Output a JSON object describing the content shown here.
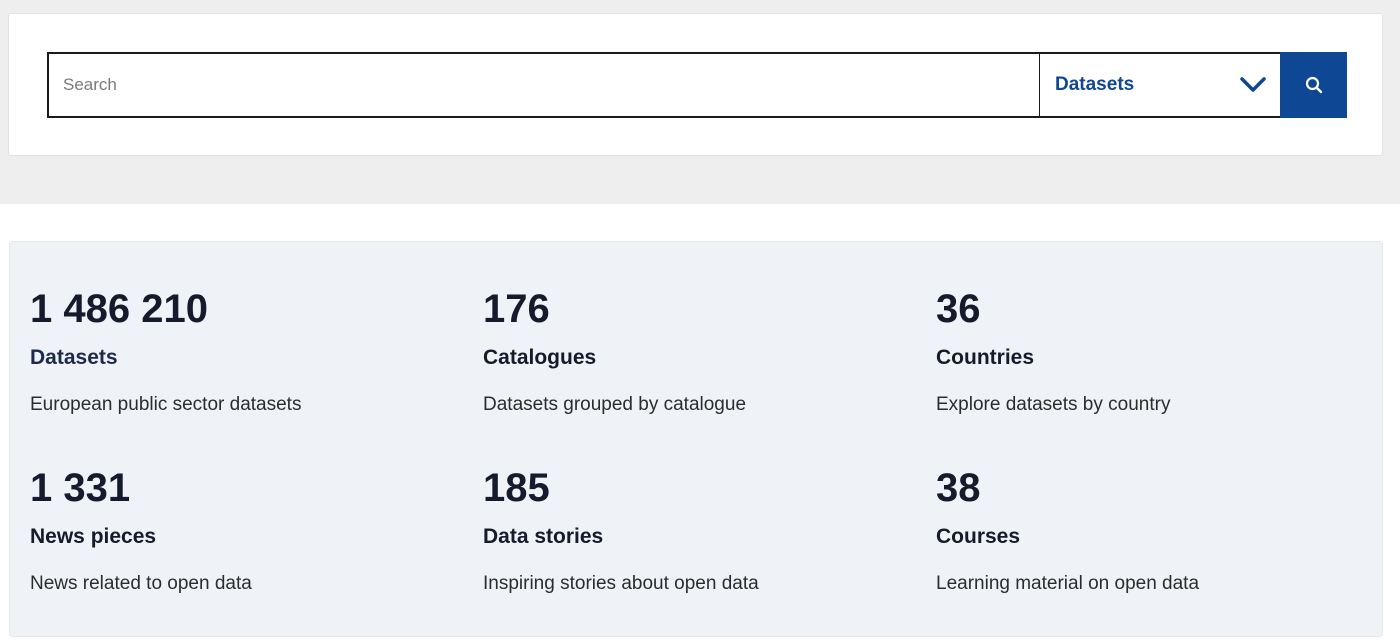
{
  "search": {
    "placeholder": "Search",
    "value": "",
    "category": "Datasets",
    "button_icon": "search-icon",
    "dropdown_icon": "chevron-down-icon",
    "accent_color": "#0e4794"
  },
  "stats": [
    {
      "number": "1 486 210",
      "title": "Datasets",
      "description": "European public sector datasets"
    },
    {
      "number": "176",
      "title": "Catalogues",
      "description": "Datasets grouped by catalogue"
    },
    {
      "number": "36",
      "title": "Countries",
      "description": "Explore datasets by country"
    },
    {
      "number": "1 331",
      "title": "News pieces",
      "description": "News related to open data"
    },
    {
      "number": "185",
      "title": "Data stories",
      "description": "Inspiring stories about open data"
    },
    {
      "number": "38",
      "title": "Courses",
      "description": "Learning material on open data"
    }
  ]
}
